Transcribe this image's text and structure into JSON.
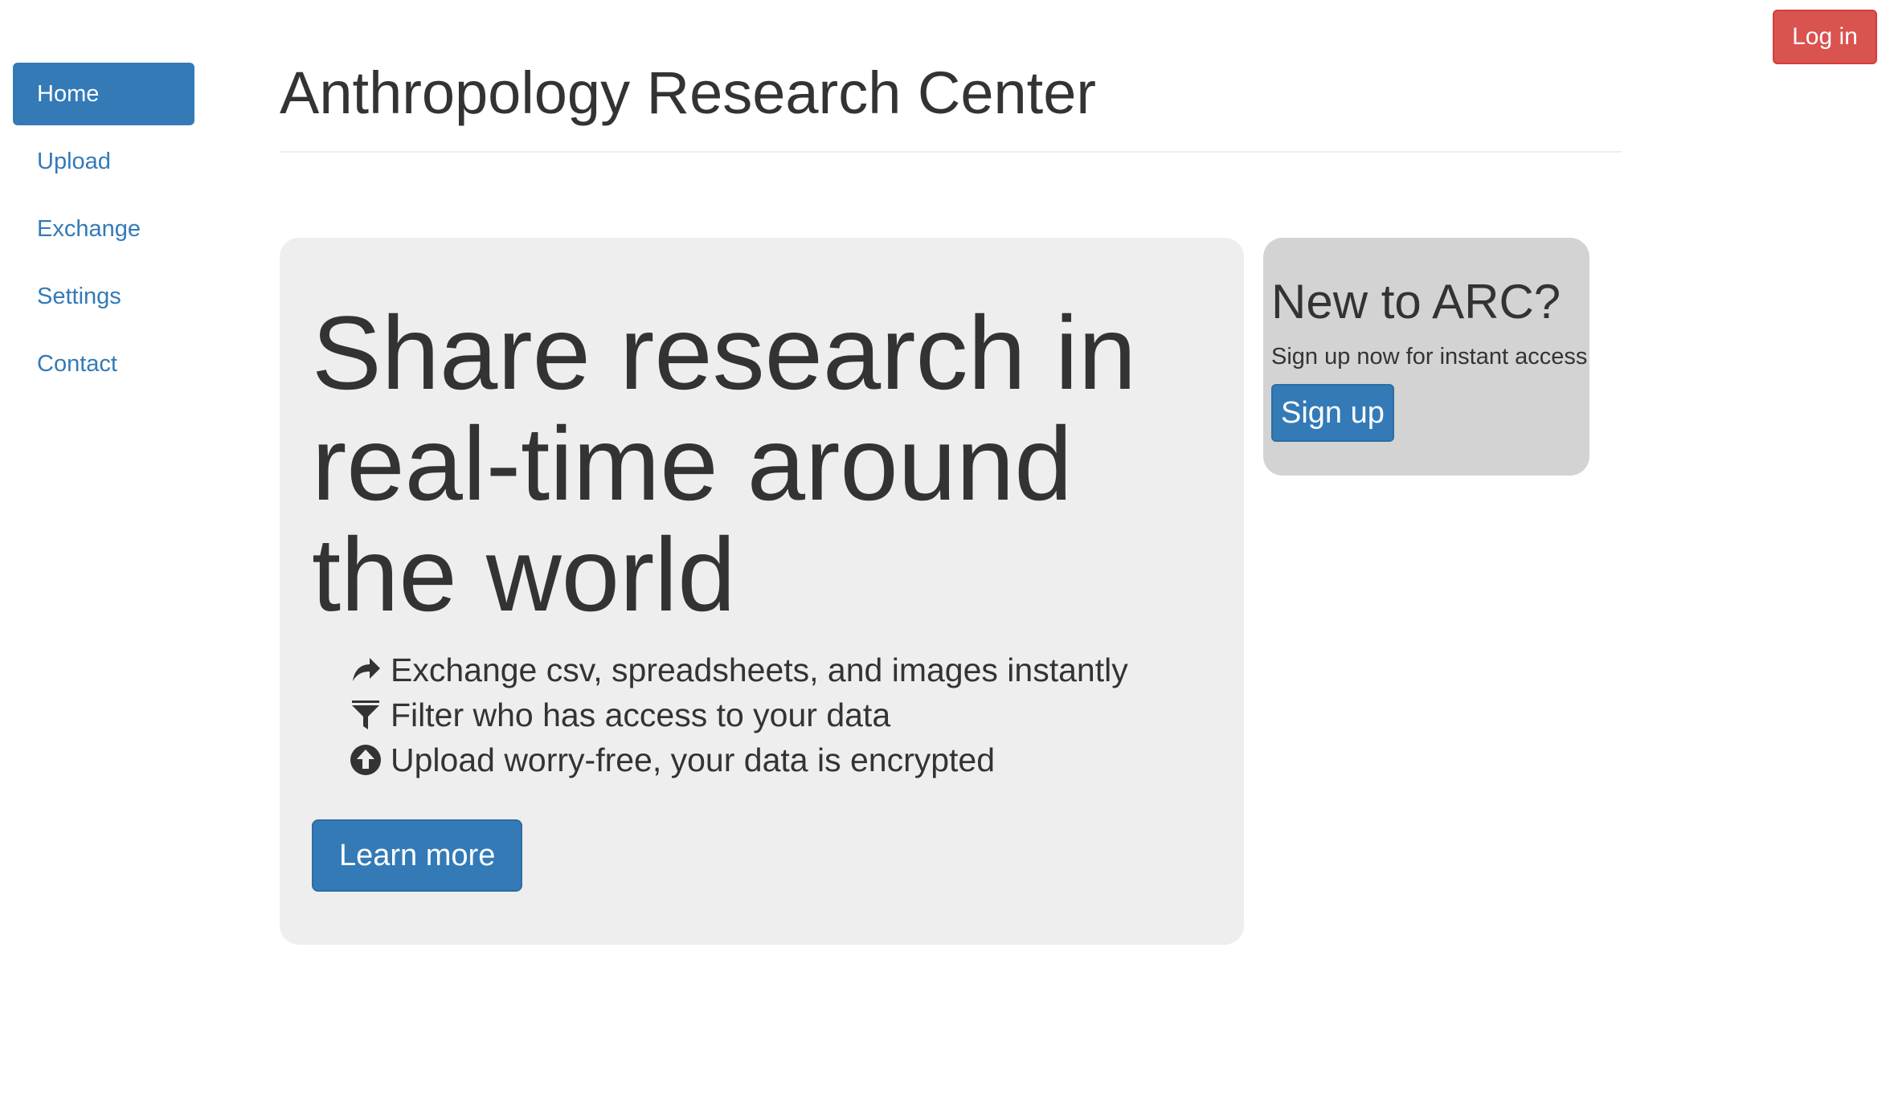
{
  "header": {
    "login_label": "Log in",
    "title": "Anthropology Research Center"
  },
  "sidebar": {
    "items": [
      {
        "label": "Home",
        "active": true
      },
      {
        "label": "Upload",
        "active": false
      },
      {
        "label": "Exchange",
        "active": false
      },
      {
        "label": "Settings",
        "active": false
      },
      {
        "label": "Contact",
        "active": false
      }
    ]
  },
  "hero": {
    "heading": "Share research in real-time around the world",
    "features": [
      {
        "icon": "share-arrow-icon",
        "text": "Exchange csv, spreadsheets, and images instantly"
      },
      {
        "icon": "filter-icon",
        "text": "Filter who has access to your data"
      },
      {
        "icon": "upload-circle-icon",
        "text": "Upload worry-free, your data is encrypted"
      }
    ],
    "button_label": "Learn more"
  },
  "signup": {
    "title": "New to ARC?",
    "text": "Sign up now for instant access",
    "button_label": "Sign up"
  },
  "colors": {
    "primary": "#337ab7",
    "danger": "#d9534f",
    "jumbotron_bg": "#eeeeee",
    "panel_bg": "#d3d3d3",
    "text": "#333333"
  }
}
